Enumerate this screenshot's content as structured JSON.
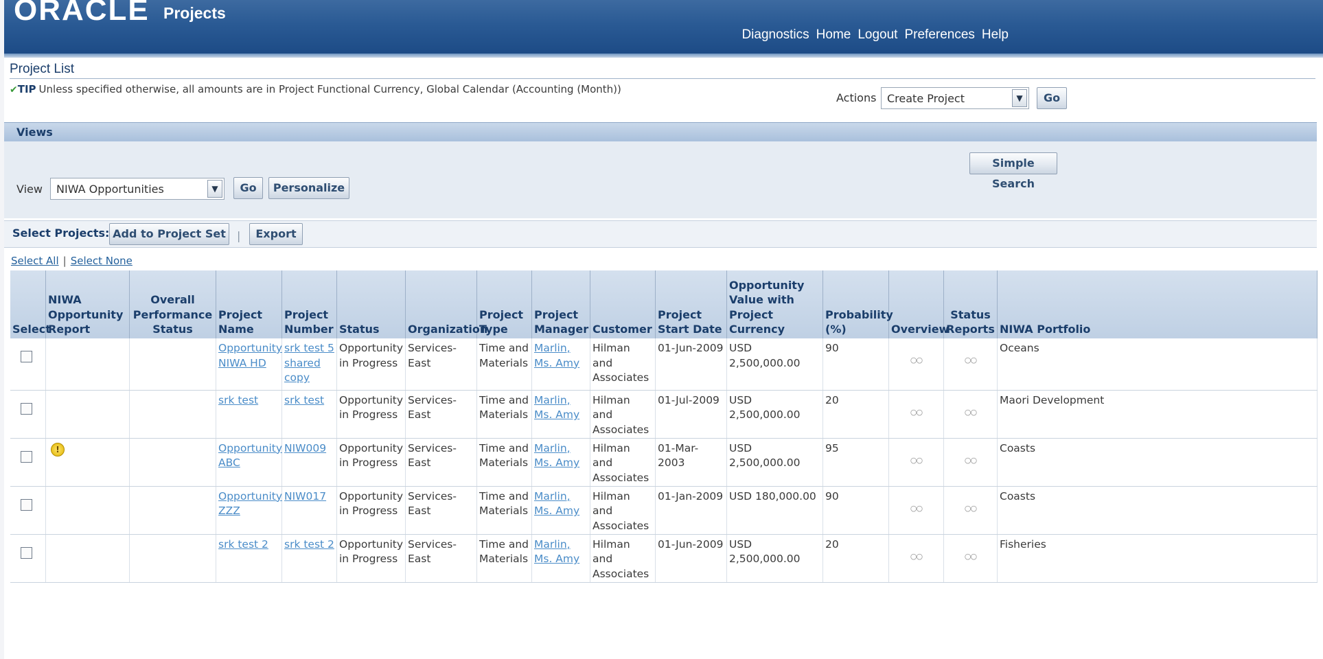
{
  "header": {
    "logo": "ORACLE",
    "app_title": "Projects",
    "links": [
      "Diagnostics",
      "Home",
      "Logout",
      "Preferences",
      "Help"
    ]
  },
  "page": {
    "title": "Project List",
    "tip_label": "TIP",
    "tip_text": "Unless specified otherwise, all amounts are in Project Functional Currency, Global Calendar (Accounting (Month))"
  },
  "actions": {
    "label": "Actions",
    "selected": "Create Project",
    "go_label": "Go"
  },
  "views": {
    "header": "Views",
    "simple_search_label": "Simple Search",
    "view_label": "View",
    "view_selected": "NIWA Opportunities",
    "go_label": "Go",
    "personalize_label": "Personalize"
  },
  "select_projects": {
    "label": "Select Projects:",
    "add_to_set_label": "Add to Project Set",
    "separator": "|",
    "export_label": "Export",
    "select_all": "Select All",
    "select_none": "Select None"
  },
  "table": {
    "headers": {
      "select": "Select",
      "report": "NIWA Opportunity Report",
      "performance": "Overall Performance Status",
      "name": "Project Name",
      "number": "Project Number",
      "status": "Status",
      "organization": "Organization",
      "type": "Project Type",
      "manager": "Project Manager",
      "customer": "Customer",
      "start_date": "Project Start Date",
      "value": "Opportunity Value with Project Currency",
      "probability": "Probability (%)",
      "overview": "Overview",
      "status_reports": "Status Reports",
      "portfolio": "NIWA Portfolio"
    },
    "rows": [
      {
        "warning": false,
        "name": "Opportunity NIWA HD",
        "number": "srk test 5 shared copy",
        "status": "Opportunity in Progress",
        "organization": "Services-East",
        "type": "Time and Materials",
        "manager": "Marlin, Ms. Amy",
        "customer": "Hilman and Associates",
        "start_date": "01-Jun-2009",
        "value": "USD 2,500,000.00",
        "probability": "90",
        "portfolio": "Oceans"
      },
      {
        "warning": false,
        "name": "srk test",
        "number": "srk test",
        "status": "Opportunity in Progress",
        "organization": "Services-East",
        "type": "Time and Materials",
        "manager": "Marlin, Ms. Amy",
        "customer": "Hilman and Associates",
        "start_date": "01-Jul-2009",
        "value": "USD 2,500,000.00",
        "probability": "20",
        "portfolio": "Maori Development"
      },
      {
        "warning": true,
        "name": "Opportunity ABC",
        "number": "NIW009",
        "status": "Opportunity in Progress",
        "organization": "Services-East",
        "type": "Time and Materials",
        "manager": "Marlin, Ms. Amy",
        "customer": "Hilman and Associates",
        "start_date": "01-Mar-2003",
        "value": "USD 2,500,000.00",
        "probability": "95",
        "portfolio": "Coasts"
      },
      {
        "warning": false,
        "name": "Opportunity ZZZ",
        "number": "NIW017",
        "status": "Opportunity in Progress",
        "organization": "Services-East",
        "type": "Time and Materials",
        "manager": "Marlin, Ms. Amy",
        "customer": "Hilman and Associates",
        "start_date": "01-Jan-2009",
        "value": "USD 180,000.00",
        "probability": "90",
        "portfolio": "Coasts"
      },
      {
        "warning": false,
        "name": "srk test 2",
        "number": "srk test 2",
        "status": "Opportunity in Progress",
        "organization": "Services-East",
        "type": "Time and Materials",
        "manager": "Marlin, Ms. Amy",
        "customer": "Hilman and Associates",
        "start_date": "01-Jun-2009",
        "value": "USD 2,500,000.00",
        "probability": "20",
        "portfolio": "Fisheries"
      }
    ]
  },
  "icons": {
    "glasses": "glasses-icon",
    "warning": "warning-icon",
    "check": "check-icon"
  },
  "colors": {
    "header_blue": "#2a5a94",
    "link_blue": "#4a8cc8",
    "label_navy": "#1b3e6b"
  }
}
